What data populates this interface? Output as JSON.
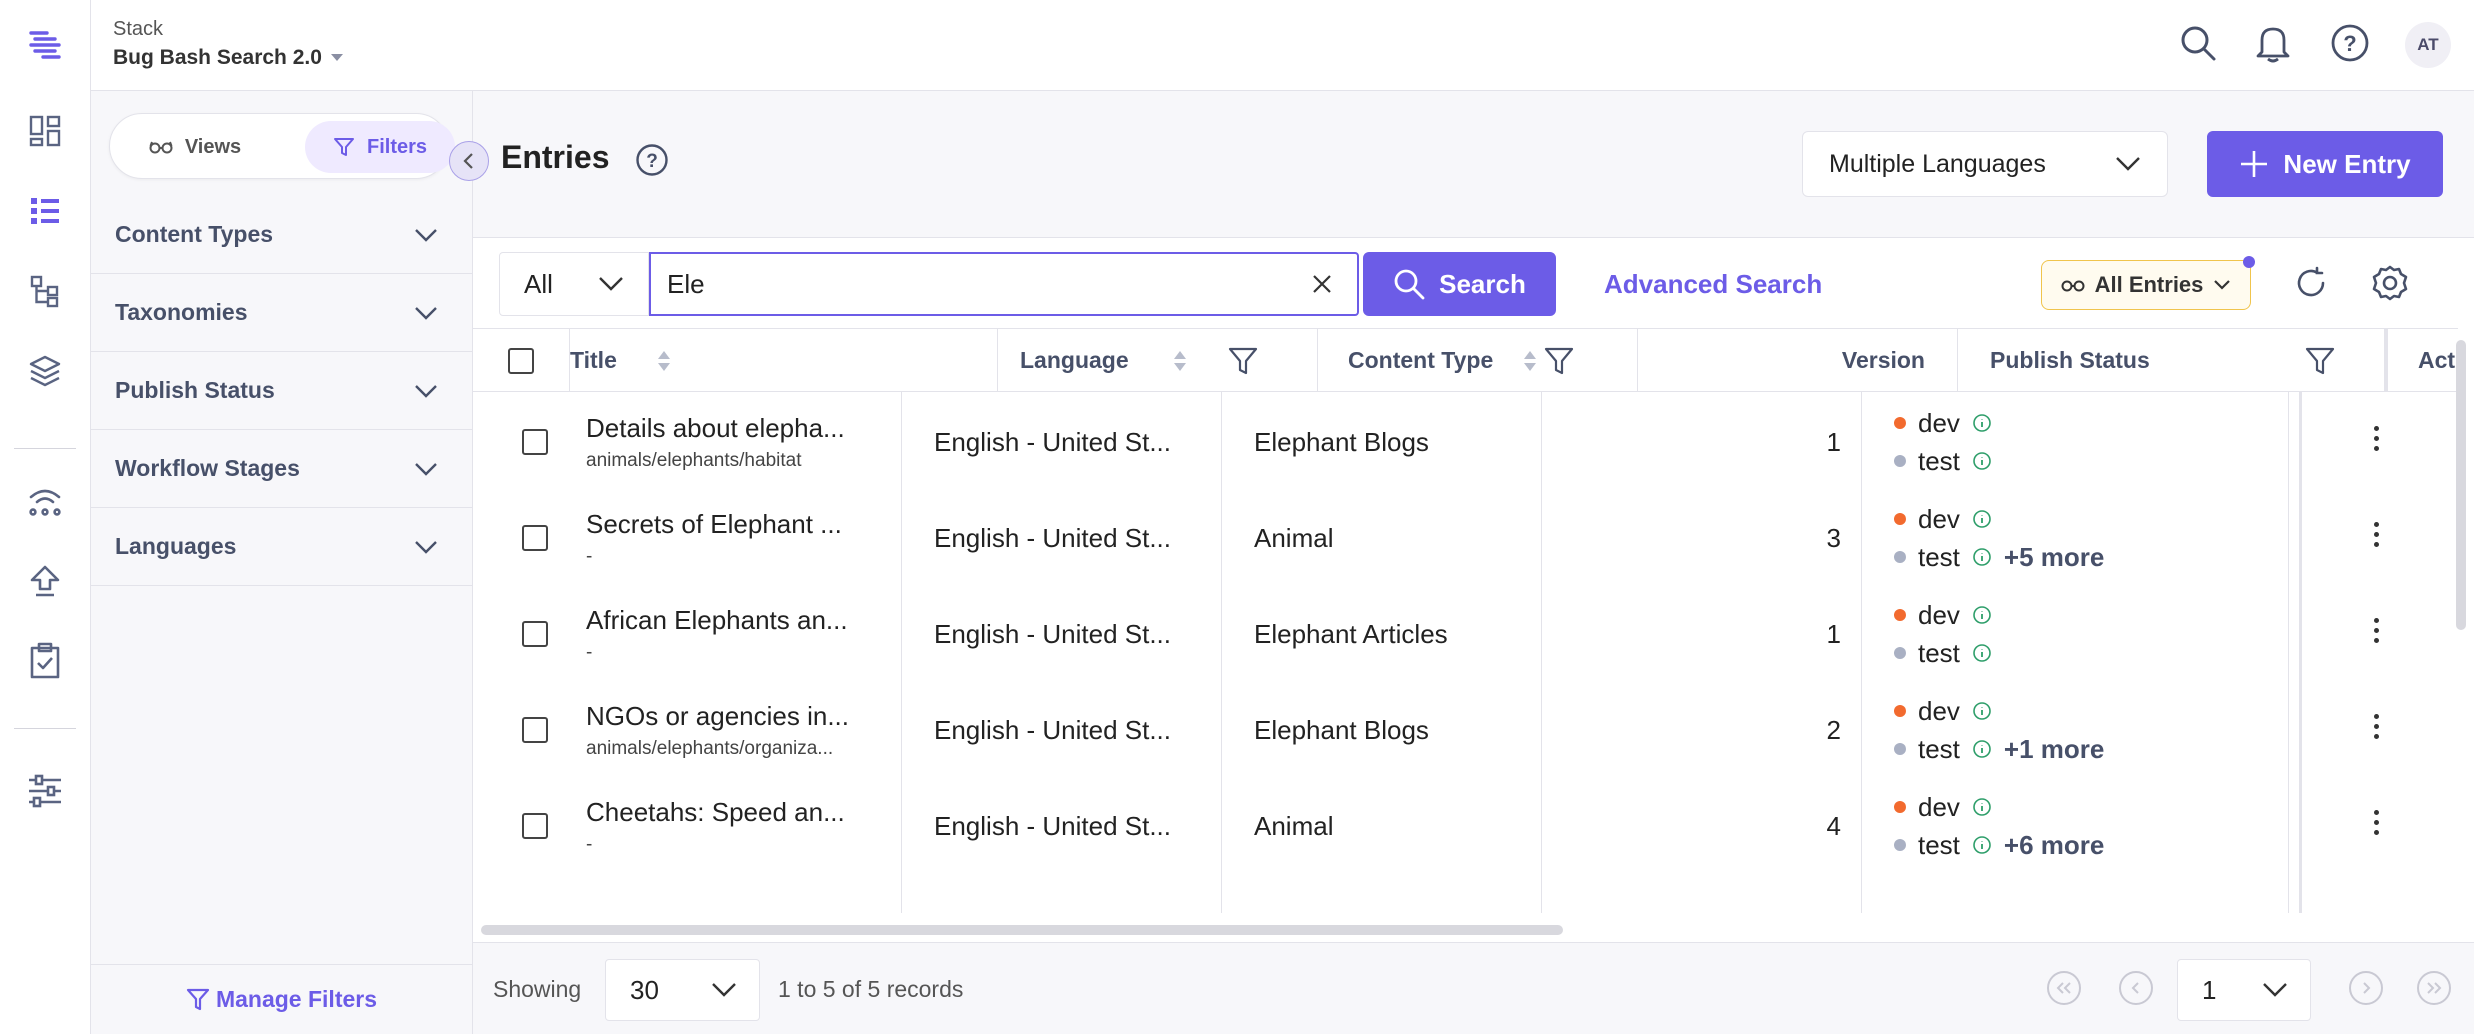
{
  "header": {
    "stack_label": "Stack",
    "stack_name": "Bug Bash Search 2.0",
    "avatar_initials": "AT"
  },
  "rail": {
    "icons": [
      "stack-logo-icon",
      "dashboard-icon",
      "entries-icon",
      "content-models-icon",
      "assets-icon",
      "releases-icon",
      "publish-queue-icon",
      "tasks-icon",
      "settings-icon"
    ]
  },
  "filter_panel": {
    "views_label": "Views",
    "filters_label": "Filters",
    "sections": [
      "Content Types",
      "Taxonomies",
      "Publish Status",
      "Workflow Stages",
      "Languages"
    ],
    "manage_label": "Manage Filters"
  },
  "page": {
    "title": "Entries",
    "language_select": "Multiple Languages",
    "new_entry_label": "New Entry"
  },
  "search": {
    "scope": "All",
    "query": "Ele",
    "button_label": "Search",
    "advanced_label": "Advanced Search",
    "all_entries_label": "All Entries"
  },
  "table": {
    "headers": {
      "title": "Title",
      "language": "Language",
      "content_type": "Content Type",
      "version": "Version",
      "publish_status": "Publish Status",
      "actions": "Actions"
    },
    "rows": [
      {
        "title": "Details about elepha...",
        "url": "animals/elephants/habitat",
        "language": "English - United St...",
        "content_type": "Elephant Blogs",
        "version": "1",
        "env1": "dev",
        "env2": "test",
        "more": ""
      },
      {
        "title": "Secrets of Elephant ...",
        "url": "-",
        "language": "English - United St...",
        "content_type": "Animal",
        "version": "3",
        "env1": "dev",
        "env2": "test",
        "more": "+5 more"
      },
      {
        "title": "African Elephants an...",
        "url": "-",
        "language": "English - United St...",
        "content_type": "Elephant Articles",
        "version": "1",
        "env1": "dev",
        "env2": "test",
        "more": ""
      },
      {
        "title": "NGOs or agencies in...",
        "url": "animals/elephants/organiza...",
        "language": "English - United St...",
        "content_type": "Elephant Blogs",
        "version": "2",
        "env1": "dev",
        "env2": "test",
        "more": "+1 more"
      },
      {
        "title": "Cheetahs: Speed an...",
        "url": "-",
        "language": "English - United St...",
        "content_type": "Animal",
        "version": "4",
        "env1": "dev",
        "env2": "test",
        "more": "+6 more"
      }
    ]
  },
  "footer": {
    "showing_label": "Showing",
    "per_page": "30",
    "records_text": "1 to 5 of 5 records",
    "page": "1"
  },
  "colors": {
    "accent": "#6c5ce7",
    "env_dev": "#f26a2e",
    "env_test": "#a9b0c3",
    "info_green": "#2e9e6a"
  }
}
